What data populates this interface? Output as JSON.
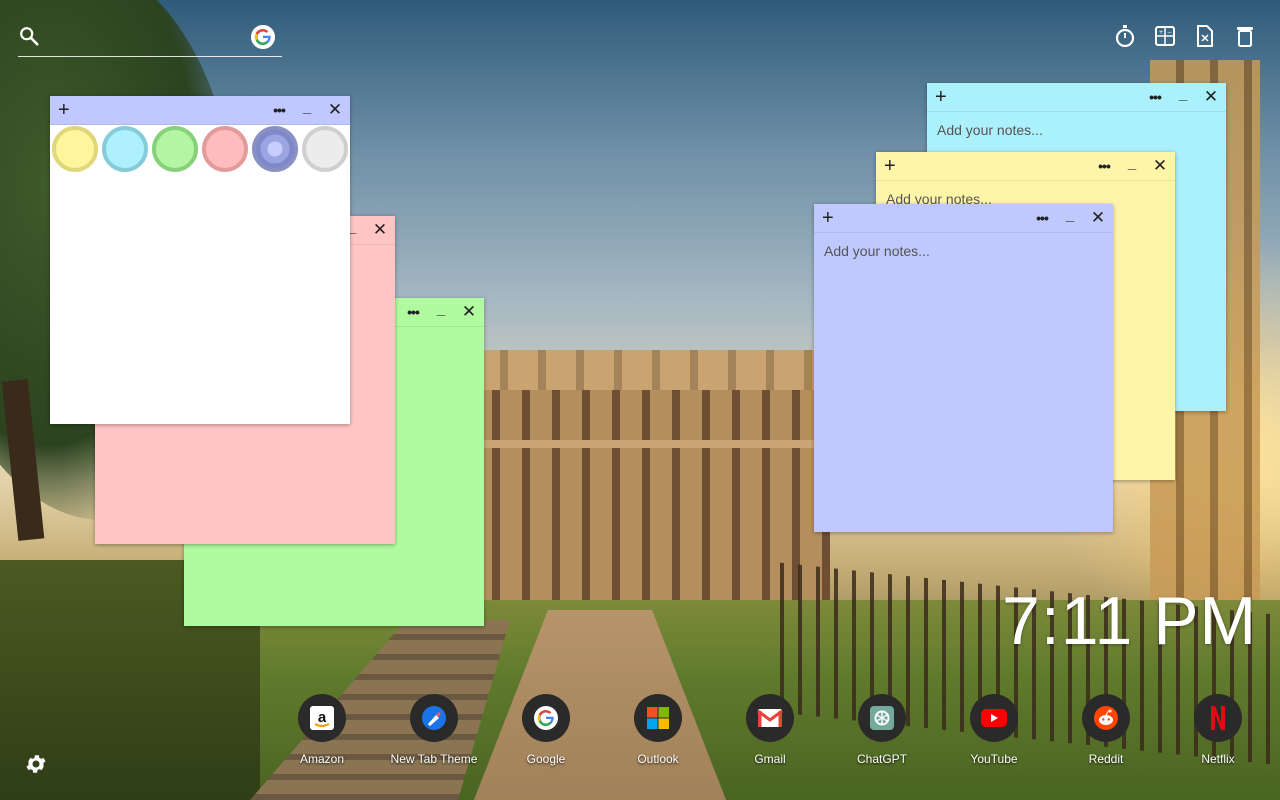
{
  "search": {
    "placeholder": "",
    "engine_icon": "google-g-icon"
  },
  "tools": [
    {
      "name": "timer-icon"
    },
    {
      "name": "calculator-icon"
    },
    {
      "name": "note-file-icon"
    },
    {
      "name": "trash-icon"
    }
  ],
  "notes": {
    "placeholder": "Add your notes...",
    "controls": {
      "add": "+",
      "more": "•••",
      "minimize": "_",
      "close": "✕"
    },
    "colors": {
      "green": "#b0fb9f",
      "pink": "#ffc5c5",
      "white": "#ffffff",
      "cyan": "#abf1fb",
      "yellow": "#fff5a8",
      "blue": "#bfc9fd"
    },
    "swatches": [
      "yellow",
      "cyan",
      "green",
      "pink",
      "blue",
      "white"
    ]
  },
  "clock": {
    "time": "7:11 PM"
  },
  "shortcuts": [
    {
      "label": "Amazon",
      "icon": "amazon-icon"
    },
    {
      "label": "New Tab Theme",
      "icon": "new-tab-theme-icon"
    },
    {
      "label": "Google",
      "icon": "google-icon"
    },
    {
      "label": "Outlook",
      "icon": "outlook-icon"
    },
    {
      "label": "Gmail",
      "icon": "gmail-icon"
    },
    {
      "label": "ChatGPT",
      "icon": "chatgpt-icon"
    },
    {
      "label": "YouTube",
      "icon": "youtube-icon"
    },
    {
      "label": "Reddit",
      "icon": "reddit-icon"
    },
    {
      "label": "Netflix",
      "icon": "netflix-icon"
    }
  ],
  "settings": {
    "icon": "gear-icon"
  }
}
